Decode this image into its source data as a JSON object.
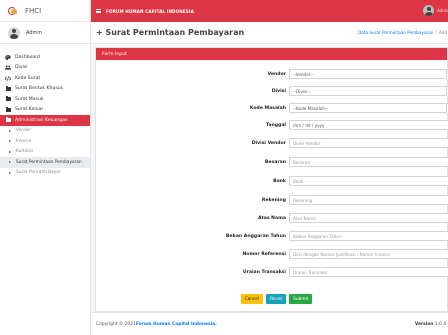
{
  "brand": {
    "name": "FHCI"
  },
  "user": {
    "name": "Admin"
  },
  "menu": [
    {
      "label": "Dashboard",
      "icon": "palette-icon"
    },
    {
      "label": "Divisi",
      "icon": "users-icon"
    },
    {
      "label": "Kode Surat",
      "icon": "code-icon"
    },
    {
      "label": "Surat Bentuk Khusus",
      "icon": "folder-icon"
    },
    {
      "label": "Surat Masuk",
      "icon": "folder-icon"
    },
    {
      "label": "Surat Keluar",
      "icon": "folder-icon"
    },
    {
      "label": "Administrasi Keuangan",
      "icon": "folder-icon"
    }
  ],
  "submenu": [
    {
      "label": "Vendor"
    },
    {
      "label": "Invoice"
    },
    {
      "label": "Kuitansi"
    },
    {
      "label": "Surat Permintaan Pembayaran"
    },
    {
      "label": "Surat Perintah Bayar"
    }
  ],
  "topbar": {
    "title": "FORUM HUMAN CAPITAL INDONESIA",
    "user_name": "Admin"
  },
  "header": {
    "title": "+ Surat Permintaan Pembayaran",
    "breadcrumb_link": "Data Surat Permintaan Pembayaran",
    "breadcrumb_sep": "/",
    "breadcrumb_current": "Add"
  },
  "card": {
    "title": "Form Input"
  },
  "form": [
    {
      "label": "Vendor",
      "type": "select",
      "value": "--Vendor--"
    },
    {
      "label": "Divisi",
      "type": "select",
      "value": "--Divisi--"
    },
    {
      "label": "Kode Masalah",
      "type": "select",
      "value": "--Kode Masalah--"
    },
    {
      "label": "Tanggal",
      "type": "date",
      "value": "mm / dd / yyyy"
    },
    {
      "label": "Divisi Vendor",
      "type": "text",
      "placeholder": "Divisi Vendor"
    },
    {
      "label": "Besaran",
      "type": "text",
      "placeholder": "Besaran"
    },
    {
      "label": "Bank",
      "type": "text",
      "placeholder": "Bank"
    },
    {
      "label": "Rekening",
      "type": "text",
      "placeholder": "Rekening"
    },
    {
      "label": "Atas Nama",
      "type": "text",
      "placeholder": "Atas Nama"
    },
    {
      "label": "Beban Anggaran Tahun",
      "type": "text",
      "placeholder": "Beban Anggaran Tahun"
    },
    {
      "label": "Nomor Referensi",
      "type": "text",
      "placeholder": "Diisi dengan Nomor Justifikasi / Nomor Invoice"
    },
    {
      "label": "Uraian Transaksi",
      "type": "text",
      "placeholder": "Uraian Transaksi"
    }
  ],
  "buttons": {
    "cancel": "Cancel",
    "reset": "Reset",
    "submit": "Submit"
  },
  "footer": {
    "copyright": "Copyright © 2021 ",
    "org": "Forum Human Capital Indonesia",
    "dot": ".",
    "version_label": "Version",
    "version": " 1.0.4"
  },
  "colors": {
    "primary": "#dc3545",
    "link": "#007bff",
    "cancel": "#ffc107",
    "reset": "#17a2b8",
    "submit": "#28a745"
  }
}
